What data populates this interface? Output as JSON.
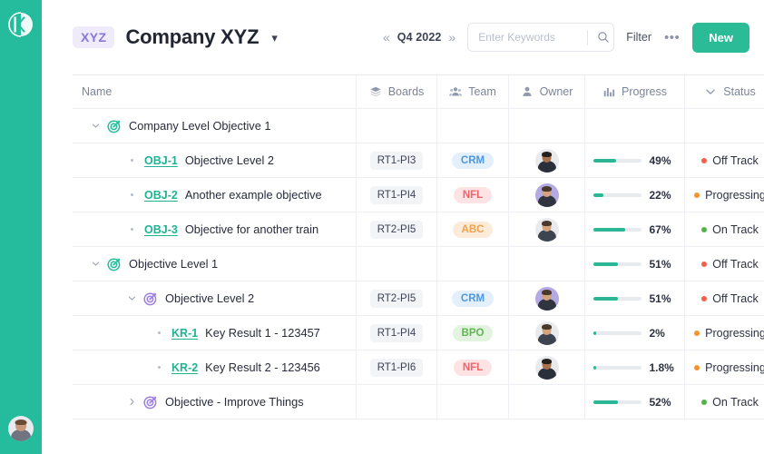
{
  "sidebar": {
    "logo_label": "K",
    "logo_icon": "kanban-k-logo-icon",
    "avatar_icon": "user-avatar"
  },
  "header": {
    "org_badge": "XYZ",
    "title": "Company XYZ",
    "title_caret_icon": "chevron-down-icon",
    "quarter": {
      "prev_icon": "«",
      "label": "Q4 2022",
      "next_icon": "»"
    },
    "search": {
      "placeholder": "Enter Keywords",
      "value": "",
      "icon": "search-icon"
    },
    "filter_label": "Filter",
    "more_label": "•••",
    "new_label": "New",
    "accent_color": "#2BBC97"
  },
  "table": {
    "columns": [
      {
        "key": "name",
        "label": "Name",
        "icon": null
      },
      {
        "key": "boards",
        "label": "Boards",
        "icon": "layers-icon"
      },
      {
        "key": "team",
        "label": "Team",
        "icon": "people-icon"
      },
      {
        "key": "owner",
        "label": "Owner",
        "icon": "person-icon"
      },
      {
        "key": "progress",
        "label": "Progress",
        "icon": "bar-chart-icon"
      },
      {
        "key": "status",
        "label": "Status",
        "icon": "chevron-down-icon"
      }
    ],
    "rows": [
      {
        "indent": 0,
        "toggle": "expanded",
        "marker": "target",
        "target_color": "#27BC99",
        "ref": null,
        "title": "Company Level Objective 1",
        "bold": true,
        "board": null,
        "team": null,
        "team_color": null,
        "team_bg": null,
        "owner": null,
        "progress": null,
        "progress_label": null,
        "status": null,
        "status_color": null
      },
      {
        "indent": 1,
        "toggle": "none",
        "marker": "dot",
        "target_color": null,
        "ref": "OBJ-1",
        "title": "Objective Level 2",
        "bold": false,
        "board": "RT1-PI3",
        "team": "CRM",
        "team_color": "#4C97E0",
        "team_bg": "#E3F0FC",
        "owner": "avatar-female-1",
        "progress": 49,
        "progress_label": "49%",
        "status": "Off Track",
        "status_color": "#F2604C"
      },
      {
        "indent": 1,
        "toggle": "none",
        "marker": "dot",
        "target_color": null,
        "ref": "OBJ-2",
        "title": "Another example objective",
        "bold": false,
        "board": "RT1-PI4",
        "team": "NFL",
        "team_color": "#F2646B",
        "team_bg": "#FDE3E4",
        "owner": "avatar-male-1",
        "progress": 22,
        "progress_label": "22%",
        "status": "Progressing",
        "status_color": "#F5942F"
      },
      {
        "indent": 1,
        "toggle": "none",
        "marker": "dot",
        "target_color": null,
        "ref": "OBJ-3",
        "title": "Objective for another train",
        "bold": false,
        "board": "RT2-PI5",
        "team": "ABC",
        "team_color": "#F2A14C",
        "team_bg": "#FDEBDA",
        "owner": "avatar-male-2",
        "progress": 67,
        "progress_label": "67%",
        "status": "On Track",
        "status_color": "#52B448"
      },
      {
        "indent": 0,
        "toggle": "expanded",
        "marker": "target",
        "target_color": "#27BC99",
        "ref": null,
        "title": "Objective Level 1",
        "bold": true,
        "board": null,
        "team": null,
        "team_color": null,
        "team_bg": null,
        "owner": null,
        "progress": 51,
        "progress_label": "51%",
        "status": "Off Track",
        "status_color": "#F2604C"
      },
      {
        "indent": 1,
        "toggle": "expanded",
        "marker": "target",
        "target_color": "#9B7FE0",
        "ref": null,
        "title": "Objective Level 2",
        "bold": true,
        "board": "RT2-PI5",
        "team": "CRM",
        "team_color": "#4C97E0",
        "team_bg": "#E3F0FC",
        "owner": "avatar-male-1",
        "progress": 51,
        "progress_label": "51%",
        "status": "Off Track",
        "status_color": "#F2604C"
      },
      {
        "indent": 2,
        "toggle": "none",
        "marker": "dot",
        "target_color": null,
        "ref": "KR-1",
        "title": "Key Result 1 -  123457",
        "bold": false,
        "board": "RT1-PI4",
        "team": "BPO",
        "team_color": "#64B457",
        "team_bg": "#E2F3DF",
        "owner": "avatar-male-2",
        "progress": 2,
        "progress_label": "2%",
        "status": "Progressing",
        "status_color": "#F5942F"
      },
      {
        "indent": 2,
        "toggle": "none",
        "marker": "dot",
        "target_color": null,
        "ref": "KR-2",
        "title": "Key Result 2 - 123456",
        "bold": false,
        "board": "RT1-PI6",
        "team": "NFL",
        "team_color": "#F2646B",
        "team_bg": "#FDE3E4",
        "owner": "avatar-female-1",
        "progress": 1.8,
        "progress_label": "1.8%",
        "status": "Progressing",
        "status_color": "#F5942F"
      },
      {
        "indent": 1,
        "toggle": "collapsed",
        "marker": "target",
        "target_color": "#9B7FE0",
        "ref": null,
        "title": "Objective - Improve Things",
        "bold": true,
        "board": null,
        "team": null,
        "team_color": null,
        "team_bg": null,
        "owner": null,
        "progress": 52,
        "progress_label": "52%",
        "status": "On Track",
        "status_color": "#52B448"
      }
    ]
  }
}
